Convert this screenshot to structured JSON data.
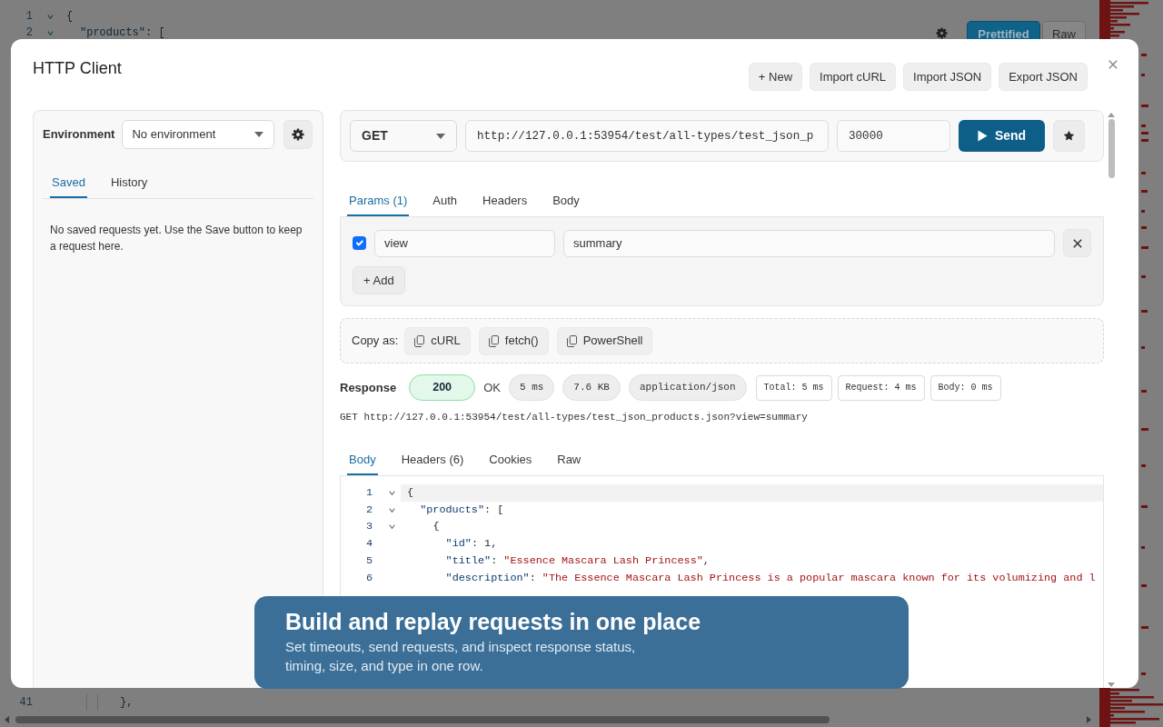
{
  "background": {
    "editor_top": [
      {
        "number": "1",
        "text": "{",
        "expanded": true,
        "children": [
          {
            "number": "2",
            "text": "\"products\": [",
            "expanded": true
          }
        ]
      }
    ],
    "editor_bottom": [
      {
        "number": "41",
        "text": "},"
      }
    ],
    "view_toggle": [
      {
        "label": "Prettified",
        "selected": true
      },
      {
        "label": "Raw",
        "selected": false
      }
    ]
  },
  "dialog": {
    "title": "HTTP Client",
    "actions": [
      "+ New",
      "Import cURL",
      "Import JSON",
      "Export JSON"
    ]
  },
  "sidebar": {
    "environment_label": "Environment",
    "environment": "No environment",
    "tabs": [
      {
        "label": "Saved",
        "selected": true
      },
      {
        "label": "History",
        "selected": false
      }
    ],
    "empty_message": "No saved requests yet. Use the Save button to keep a request here."
  },
  "request": {
    "method": "GET",
    "url": "http://127.0.0.1:53954/test/all-types/test_json_p",
    "timeout": "30000",
    "send_label": "Send"
  },
  "request_tabs": [
    {
      "label": "Params (1)",
      "selected": true
    },
    {
      "label": "Auth",
      "selected": false
    },
    {
      "label": "Headers",
      "selected": false
    },
    {
      "label": "Body",
      "selected": false
    }
  ],
  "params": [
    {
      "enabled": true,
      "key": "view",
      "value": "summary"
    }
  ],
  "add_param_label": "+ Add",
  "copy_as": {
    "label": "Copy as:",
    "formats": [
      "cURL",
      "fetch()",
      "PowerShell"
    ]
  },
  "response": {
    "label": "Response",
    "status_code": "200",
    "status_text": "OK",
    "time": "5 ms",
    "size": "7.6 KB",
    "content_type": "application/json",
    "timings": [
      "Total: 5 ms",
      "Request: 4 ms",
      "Body: 0 ms"
    ],
    "request_line": "GET http://127.0.0.1:53954/test/all-types/test_json_products.json?view=summary"
  },
  "response_tabs": [
    {
      "label": "Body",
      "selected": true
    },
    {
      "label": "Headers (6)",
      "selected": false
    },
    {
      "label": "Cookies",
      "selected": false
    },
    {
      "label": "Raw",
      "selected": false
    }
  ],
  "body_lines": [
    {
      "number": "1",
      "current": true,
      "expanded": true,
      "tokens": [
        {
          "kind": "punct",
          "text": "{"
        }
      ],
      "children": [
        {
          "number": "2",
          "current": false,
          "expanded": true,
          "tokens": [
            {
              "kind": "key",
              "text": "\"products\""
            },
            {
              "kind": "punct",
              "text": ": ["
            }
          ],
          "children": [
            {
              "number": "3",
              "current": false,
              "expanded": true,
              "tokens": [
                {
                  "kind": "punct",
                  "text": "{"
                }
              ],
              "children": [
                {
                  "number": "4",
                  "current": false,
                  "tokens": [
                    {
                      "kind": "key",
                      "text": "\"id\""
                    },
                    {
                      "kind": "punct",
                      "text": ": "
                    },
                    {
                      "kind": "number",
                      "text": "1"
                    },
                    {
                      "kind": "punct",
                      "text": ","
                    }
                  ]
                },
                {
                  "number": "5",
                  "current": false,
                  "tokens": [
                    {
                      "kind": "key",
                      "text": "\"title\""
                    },
                    {
                      "kind": "punct",
                      "text": ": "
                    },
                    {
                      "kind": "string",
                      "text": "\"Essence Mascara Lash Princess\""
                    },
                    {
                      "kind": "punct",
                      "text": ","
                    }
                  ]
                },
                {
                  "number": "6",
                  "current": false,
                  "tokens": [
                    {
                      "kind": "key",
                      "text": "\"description\""
                    },
                    {
                      "kind": "punct",
                      "text": ": "
                    },
                    {
                      "kind": "string",
                      "text": "\"The Essence Mascara Lash Princess is a popular mascara known for its volumizing and l"
                    }
                  ]
                }
              ]
            }
          ]
        }
      ]
    }
  ],
  "caption": {
    "title": "Build and replay requests in one place",
    "text": "Set timeouts, send requests, and inspect response status, timing, size, and type in one row."
  }
}
